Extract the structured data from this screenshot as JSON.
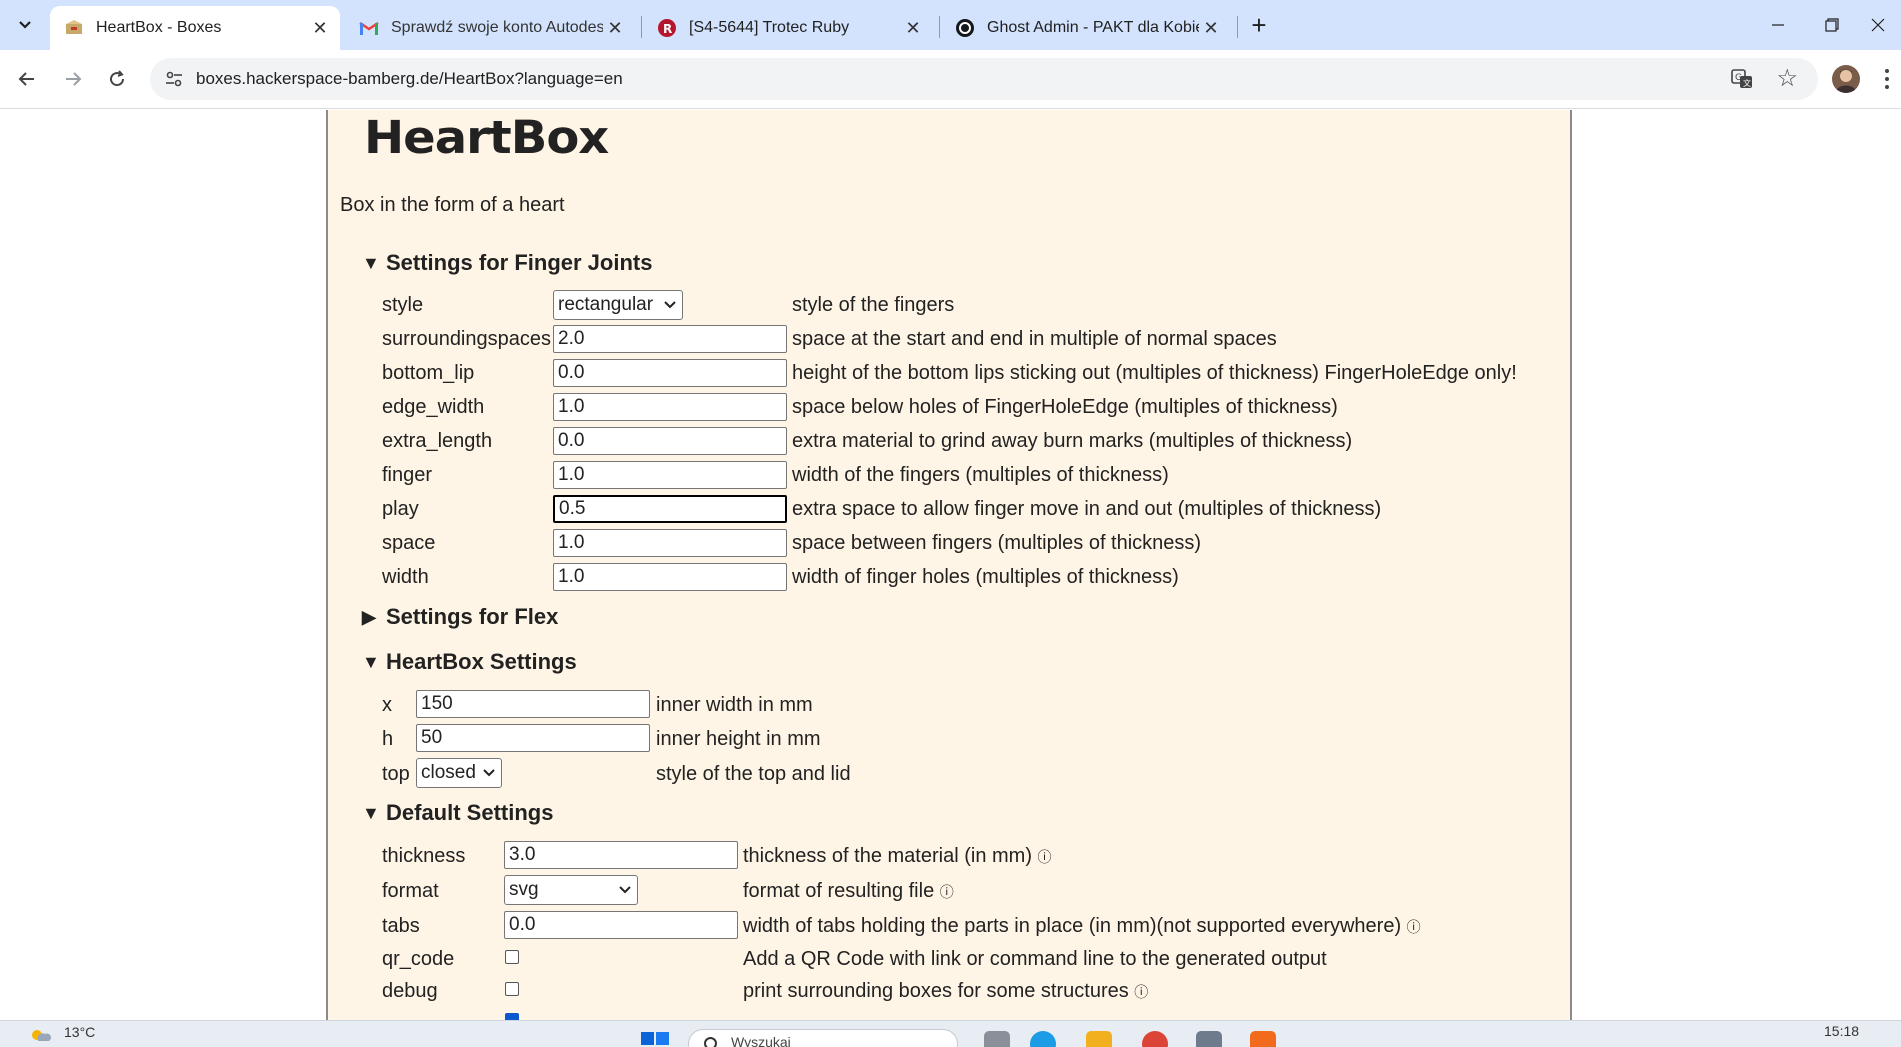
{
  "browser": {
    "tabs": [
      {
        "title": "HeartBox - Boxes",
        "active": true
      },
      {
        "title": "Sprawdź swoje konto Autodesk",
        "active": false
      },
      {
        "title": "[S4-5644] Trotec Ruby",
        "active": false
      },
      {
        "title": "Ghost Admin - PAKT dla Kobiet",
        "active": false
      }
    ],
    "url": "boxes.hackerspace-bamberg.de/HeartBox?language=en"
  },
  "page": {
    "logo": "HeartBox",
    "description": "Box in the form of a heart",
    "finger": {
      "title": "Settings for Finger Joints",
      "rows": [
        {
          "label": "style",
          "value": "rectangular",
          "hint": "style of the fingers",
          "type": "select"
        },
        {
          "label": "surroundingspaces",
          "value": "2.0",
          "hint": "space at the start and end in multiple of normal spaces",
          "type": "input"
        },
        {
          "label": "bottom_lip",
          "value": "0.0",
          "hint": "height of the bottom lips sticking out (multiples of thickness) FingerHoleEdge only!",
          "type": "input"
        },
        {
          "label": "edge_width",
          "value": "1.0",
          "hint": "space below holes of FingerHoleEdge (multiples of thickness)",
          "type": "input"
        },
        {
          "label": "extra_length",
          "value": "0.0",
          "hint": "extra material to grind away burn marks (multiples of thickness)",
          "type": "input"
        },
        {
          "label": "finger",
          "value": "1.0",
          "hint": "width of the fingers (multiples of thickness)",
          "type": "input"
        },
        {
          "label": "play",
          "value": "0.5",
          "hint": "extra space to allow finger move in and out (multiples of thickness)",
          "type": "input"
        },
        {
          "label": "space",
          "value": "1.0",
          "hint": "space between fingers (multiples of thickness)",
          "type": "input"
        },
        {
          "label": "width",
          "value": "1.0",
          "hint": "width of finger holes (multiples of thickness)",
          "type": "input"
        }
      ]
    },
    "flex": {
      "title": "Settings for Flex"
    },
    "heartbox": {
      "title": "HeartBox Settings",
      "rows": [
        {
          "label": "x",
          "value": "150",
          "hint": "inner width in mm",
          "type": "input"
        },
        {
          "label": "h",
          "value": "50",
          "hint": "inner height in mm",
          "type": "input"
        },
        {
          "label": "top",
          "value": "closed",
          "hint": "style of the top and lid",
          "type": "select"
        }
      ]
    },
    "defaults": {
      "title": "Default Settings",
      "rows": [
        {
          "label": "thickness",
          "value": "3.0",
          "hint": "thickness of the material (in mm)",
          "type": "input"
        },
        {
          "label": "format",
          "value": "svg",
          "hint": "format of resulting file",
          "type": "select"
        },
        {
          "label": "tabs",
          "value": "0.0",
          "hint": "width of tabs holding the parts in place (in mm)(not supported everywhere)",
          "type": "input"
        },
        {
          "label": "qr_code",
          "checked": false,
          "hint": "Add a QR Code with link or command line to the generated output",
          "type": "checkbox"
        },
        {
          "label": "debug",
          "checked": false,
          "hint": "print surrounding boxes for some structures",
          "type": "checkbox"
        }
      ]
    },
    "info_glyph": "ⓘ"
  },
  "taskbar": {
    "temperature": "13°C",
    "search_placeholder": "Wyszukaj",
    "clock": "15:18"
  },
  "colors": {
    "panel_bg": "#fff5e6",
    "tabstrip_bg": "#d3e3fd",
    "checkbox_on": "#0b57d0"
  }
}
